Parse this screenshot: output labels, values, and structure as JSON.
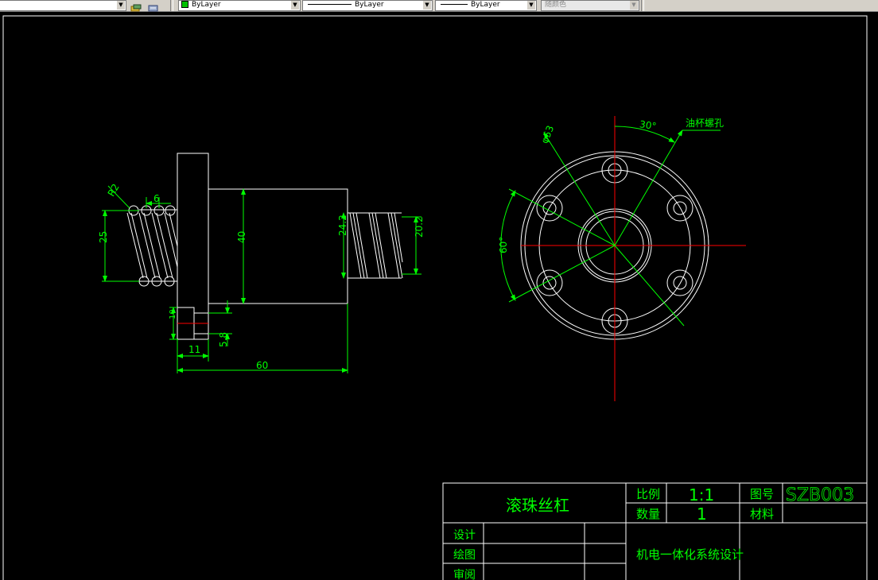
{
  "toolbar": {
    "layer_color_label": "ByLayer",
    "linetype_label": "ByLayer",
    "lineweight_label": "ByLayer",
    "plotstyle_label": "随颜色"
  },
  "drawing": {
    "dims": {
      "d_r": "R2",
      "d_pitch": "6",
      "d_25": "25",
      "d_40": "40",
      "d_242": "24.2",
      "d_202": "20.2",
      "d_10": "10",
      "d_58": "5.8",
      "d_11": "11",
      "d_60": "60",
      "d_phi53": "φ53",
      "d_30deg": "30°",
      "d_60deg": "60°",
      "oil_hole": "油杯螺孔"
    },
    "title_block": {
      "part_name": "滚珠丝杠",
      "scale_label": "比例",
      "scale_value": "1:1",
      "drawing_no_label": "图号",
      "drawing_no": "SZB003",
      "qty_label": "数量",
      "qty_value": "1",
      "material_label": "材料",
      "design_label": "设计",
      "draw_label": "绘图",
      "review_label": "审阅",
      "project": "机电一体化系统设计"
    }
  },
  "colors": {
    "background": "#000000",
    "geometry": "#ffffff",
    "dimension": "#00ff00",
    "center": "#ff0000"
  }
}
